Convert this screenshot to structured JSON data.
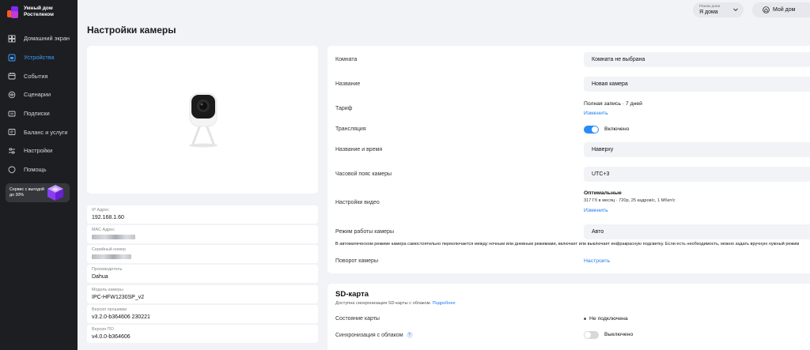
{
  "app": {
    "logo_text": "Умный дом Ростелеком"
  },
  "sidebar": {
    "items": [
      {
        "label": "Домашний экран",
        "icon": "home-screen-icon"
      },
      {
        "label": "Устройства",
        "icon": "devices-icon",
        "active": true
      },
      {
        "label": "События",
        "icon": "events-icon"
      },
      {
        "label": "Сценарии",
        "icon": "scenarios-icon"
      },
      {
        "label": "Подписки",
        "icon": "subscriptions-icon"
      },
      {
        "label": "Баланс и услуги",
        "icon": "balance-icon"
      },
      {
        "label": "Настройки",
        "icon": "settings-icon"
      },
      {
        "label": "Помощь",
        "icon": "help-icon"
      }
    ],
    "promo": {
      "text": "Сервис с выгодой до 30%"
    }
  },
  "header": {
    "title": "Настройки камеры",
    "home_mode": {
      "label": "Режим дома",
      "value": "Я дома"
    },
    "my_home_button": "Мой дом"
  },
  "camera_info": [
    {
      "key": "IP Адрес",
      "value": "192.168.1.60"
    },
    {
      "key": "MAC Адрес",
      "value": ""
    },
    {
      "key": "Серийный номер",
      "value": ""
    },
    {
      "key": "Производитель",
      "value": "Dahua"
    },
    {
      "key": "Модель камеры",
      "value": "IPC-HFW1230SP_v2"
    },
    {
      "key": "Версия прошивки",
      "value": "v3.2.0-b364606 230221"
    },
    {
      "key": "Версия ПО",
      "value": "v4.0.0-b364606"
    }
  ],
  "settings": {
    "room": {
      "label": "Комната",
      "value": "Комната не выбрана"
    },
    "name": {
      "label": "Название",
      "value": "Новая камера"
    },
    "tariff": {
      "label": "Тариф",
      "value": "Полная запись · 7 дней",
      "link": "Изменить"
    },
    "stream": {
      "label": "Трансляция",
      "value": "Включено",
      "on": true
    },
    "name_time": {
      "label": "Название и время",
      "value": "Наверху"
    },
    "timezone": {
      "label": "Часовой пояс камеры",
      "value": "UTC+3"
    },
    "video": {
      "label": "Настройки видео",
      "value": "Оптимальные",
      "detail": "317 Гб в месяц · 720p, 25 кадров/с, 1 Мбит/с",
      "link": "Изменить"
    },
    "mode": {
      "label": "Режим работы камеры",
      "value": "Авто"
    },
    "mode_hint": "В автоматическом режиме камера самостоятельно переключается между ночным или дневным режимами, включает или выключает инфракрасную подсветку. Если есть необходимость, можно задать вручную нужный режим",
    "rotate": {
      "label": "Поворот камеры",
      "link": "Настроить"
    }
  },
  "sd": {
    "title": "SD-карта",
    "subtitle": "Доступна синхронизация SD-карты с облаком.",
    "subtitle_link": "Подробнее",
    "state": {
      "label": "Состояние карты",
      "value": "Не подключена"
    },
    "sync": {
      "label": "Синхронизация с облаком",
      "value": "Выключено",
      "on": false
    }
  },
  "colors": {
    "accent": "#2a8cf8",
    "sidebar_bg": "#1d1e22",
    "page_bg": "#f2f3f7"
  }
}
